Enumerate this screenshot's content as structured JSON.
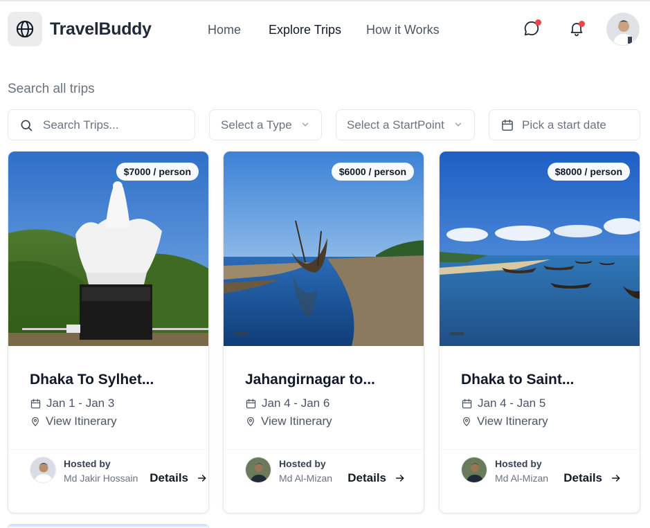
{
  "app": {
    "brand": "TravelBuddy",
    "logo_icon": "globe-icon"
  },
  "nav": {
    "items": [
      {
        "label": "Home",
        "active": false
      },
      {
        "label": "Explore Trips",
        "active": true
      },
      {
        "label": "How it Works",
        "active": false
      }
    ]
  },
  "header_actions": {
    "message_icon": "chat-bubble-icon",
    "notification_icon": "bell-icon",
    "badge_color": "#ef4444"
  },
  "filters": {
    "title": "Search all trips",
    "search_placeholder": "Search Trips...",
    "type_placeholder": "Select a Type",
    "startpoint_placeholder": "Select a StartPoint",
    "date_placeholder": "Pick a start date"
  },
  "trips": [
    {
      "price": "$7000 / person",
      "title": "Dhaka To Sylhet...",
      "dates": "Jan 1 - Jan 3",
      "itinerary_label": "View Itinerary",
      "host_label": "Hosted by",
      "host_name": "Md Jakir Hossain",
      "details_label": "Details"
    },
    {
      "price": "$6000 / person",
      "title": "Jahangirnagar to...",
      "dates": "Jan 4 - Jan 6",
      "itinerary_label": "View Itinerary",
      "host_label": "Hosted by",
      "host_name": "Md Al-Mizan",
      "details_label": "Details"
    },
    {
      "price": "$8000 / person",
      "title": "Dhaka to Saint...",
      "dates": "Jan 4 - Jan 5",
      "itinerary_label": "View Itinerary",
      "host_label": "Hosted by",
      "host_name": "Md Al-Mizan",
      "details_label": "Details"
    }
  ]
}
